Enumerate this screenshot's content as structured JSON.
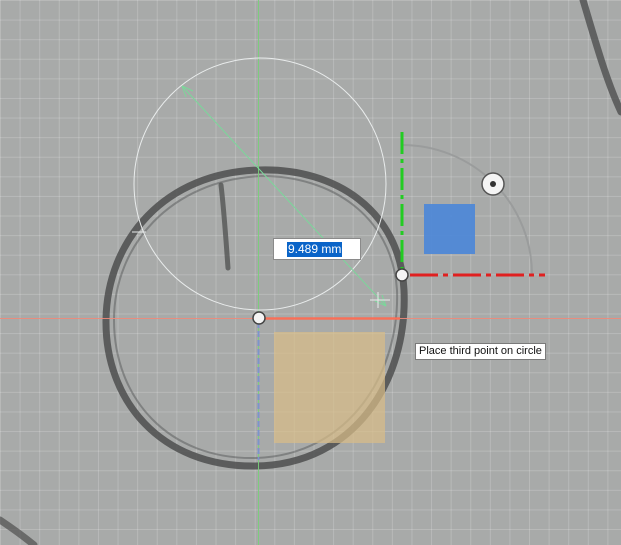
{
  "sketch": {
    "dimension_input": {
      "value": "9.489 mm"
    },
    "tooltip": {
      "text": "Place third point on circle"
    },
    "colors": {
      "canvas_background": "#a8aaa9",
      "grid_line": "#c4c6c5",
      "pencil_stroke": "#4e4f4f",
      "preview_circle": "#e9ecec",
      "y_axis": "#79d07a",
      "x_axis": "#f08a7a",
      "constraint_green": "#22cc22",
      "constraint_red": "#e02020",
      "dimension_arrow": "#7ad89a",
      "vertical_plane_blue": "#4a86d8",
      "horizontal_plane_tan": "#d8bc88",
      "selection_highlight": "#0a64c8"
    },
    "icons": {
      "center_point": "center-point-icon",
      "snap_point": "snap-point-icon",
      "rotation_handle": "rotation-handle-icon"
    }
  }
}
